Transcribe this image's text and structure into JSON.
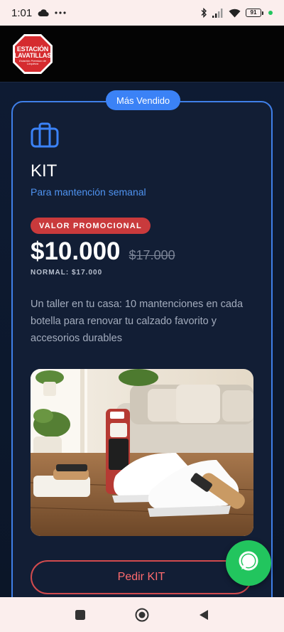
{
  "status_bar": {
    "time": "1:01",
    "icons": [
      "cloud-icon",
      "more-dots-icon",
      "bluetooth-icon",
      "signal-icon",
      "wifi-icon",
      "battery-icon"
    ],
    "battery_level": "91"
  },
  "header": {
    "logo": {
      "line1": "ESTACIÓN",
      "line2": "LAVATILLAS",
      "tagline": "Estación Premium de Limpieza"
    }
  },
  "card": {
    "badge": "Más Vendido",
    "icon": "briefcase-icon",
    "title": "KIT",
    "subtitle": "Para mantención semanal",
    "promo_label": "VALOR PROMOCIONAL",
    "price": "$10.000",
    "old_price": "$17.000",
    "normal_price": "NORMAL: $17.000",
    "description": "Un taller en tu casa: 10 mantenciones en cada botella para renovar tu calzado favorito y accesorios durables",
    "cta": "Pedir KIT"
  },
  "fab": {
    "icon": "chat-bubble-icon"
  },
  "nav": {
    "icons": [
      "recents-square-icon",
      "home-circle-icon",
      "back-triangle-icon"
    ]
  },
  "colors": {
    "accent_blue": "#3b82f6",
    "promo_red": "#c93a3c",
    "cta_red": "#d14b4e",
    "whatsapp_green": "#22c55e",
    "background": "#0e1b33"
  }
}
